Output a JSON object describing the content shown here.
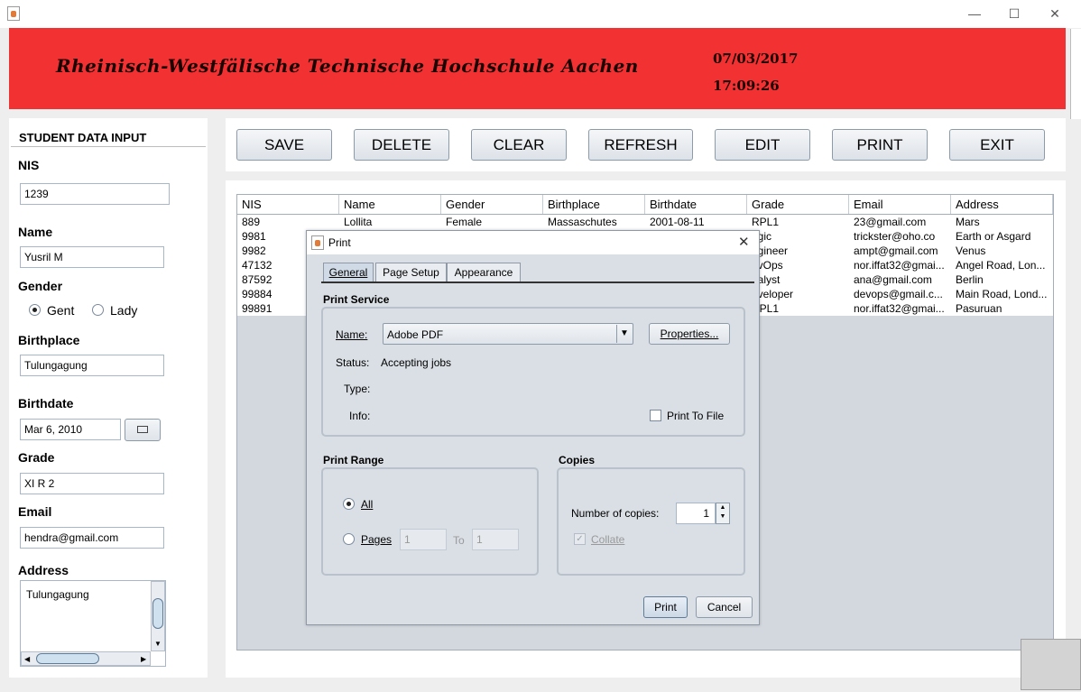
{
  "window": {
    "minimize": "—",
    "maximize": "☐",
    "close": "✕"
  },
  "banner": {
    "title": "Rheinisch-Westfälische Technische Hochschule Aachen",
    "date": "07/03/2017",
    "time": "17:09:26",
    "background": "#f23232"
  },
  "form": {
    "title": "STUDENT DATA INPUT",
    "nis_label": "NIS",
    "nis_value": "1239",
    "name_label": "Name",
    "name_value": "Yusril M",
    "gender_label": "Gender",
    "gender_options": [
      "Gent",
      "Lady"
    ],
    "gender_selected": "Gent",
    "birthplace_label": "Birthplace",
    "birthplace_value": "Tulungagung",
    "birthdate_label": "Birthdate",
    "birthdate_value": "Mar 6, 2010",
    "grade_label": "Grade",
    "grade_value": "XI R 2",
    "email_label": "Email",
    "email_value": "hendra@gmail.com",
    "address_label": "Address",
    "address_value": "Tulungagung"
  },
  "toolbar": {
    "save": "SAVE",
    "delete": "DELETE",
    "clear": "CLEAR",
    "refresh": "REFRESH",
    "edit": "EDIT",
    "print": "PRINT",
    "exit": "EXIT"
  },
  "table": {
    "columns": [
      "NIS",
      "Name",
      "Gender",
      "Birthplace",
      "Birthdate",
      "Grade",
      "Email",
      "Address"
    ],
    "rows": [
      [
        "889",
        "Lollita",
        "Female",
        "Massaschutes",
        "2001-08-11",
        "RPL1",
        "23@gmail.com",
        "Mars"
      ],
      [
        "9981",
        "",
        "",
        "",
        "",
        "agic",
        "trickster@oho.co",
        "Earth or Asgard"
      ],
      [
        "9982",
        "",
        "",
        "",
        "",
        "ngineer",
        "ampt@gmail.com",
        "Venus"
      ],
      [
        "47132",
        "",
        "",
        "",
        "",
        "evOps",
        "nor.iffat32@gmai...",
        "Angel Road, Lon..."
      ],
      [
        "87592",
        "",
        "",
        "",
        "",
        "nalyst",
        "ana@gmail.com",
        "Berlin"
      ],
      [
        "99884",
        "",
        "",
        "",
        "",
        "eveloper",
        "devops@gmail.c...",
        "Main Road, Lond..."
      ],
      [
        "99891",
        "",
        "",
        "",
        "",
        "RPL1",
        "nor.iffat32@gmai...",
        "Pasuruan"
      ]
    ]
  },
  "print_dialog": {
    "title": "Print",
    "tabs": [
      "General",
      "Page Setup",
      "Appearance"
    ],
    "active_tab": "General",
    "print_service_label": "Print Service",
    "name_label": "Name:",
    "printer": "Adobe PDF",
    "properties_button": "Properties...",
    "status_label": "Status:",
    "status_value": "Accepting jobs",
    "type_label": "Type:",
    "info_label": "Info:",
    "print_to_file_label": "Print To File",
    "print_range_label": "Print Range",
    "all_label": "All",
    "pages_label": "Pages",
    "pages_from": "1",
    "to_label": "To",
    "pages_to": "1",
    "copies_label": "Copies",
    "number_of_copies_label": "Number of copies:",
    "copies_value": "1",
    "collate_label": "Collate",
    "print_button": "Print",
    "cancel_button": "Cancel"
  }
}
